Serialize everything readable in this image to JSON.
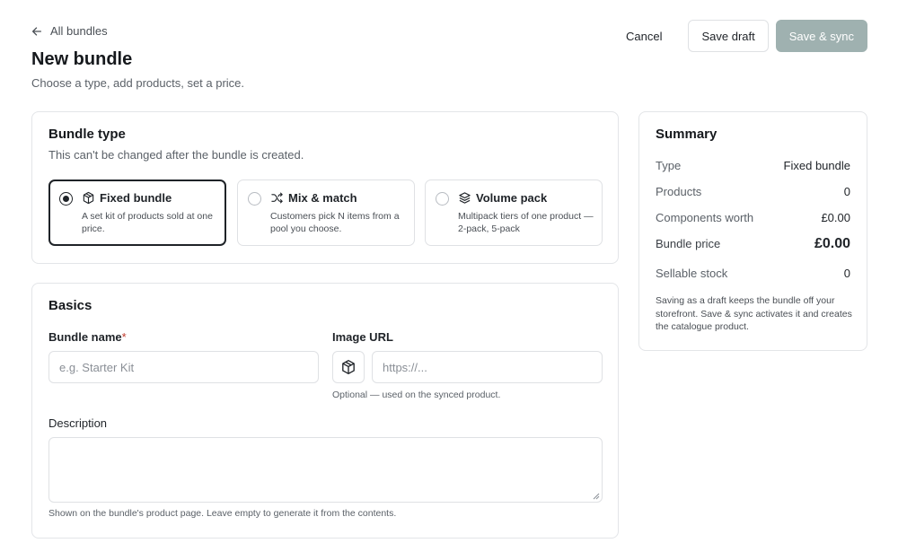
{
  "header": {
    "back_label": "All bundles",
    "title": "New bundle",
    "subtitle": "Choose a type, add products, set a price."
  },
  "actions": {
    "cancel_label": "Cancel",
    "save_draft_label": "Save draft",
    "save_sync_label": "Save & sync"
  },
  "bundle_type": {
    "title": "Bundle type",
    "subtitle": "This can't be changed after the bundle is created.",
    "options": [
      {
        "title": "Fixed bundle",
        "description": "A set kit of products sold at one price.",
        "icon": "package-icon",
        "selected": true
      },
      {
        "title": "Mix & match",
        "description": "Customers pick N items from a pool you choose.",
        "icon": "shuffle-icon",
        "selected": false
      },
      {
        "title": "Volume pack",
        "description": "Multipack tiers of one product — 2-pack, 5-pack",
        "icon": "layers-icon",
        "selected": false
      }
    ]
  },
  "basics": {
    "title": "Basics",
    "bundle_name_label": "Bundle name",
    "required_mark": "*",
    "bundle_name_placeholder": "e.g. Starter Kit",
    "image_url_label": "Image URL",
    "image_url_placeholder": "https://...",
    "image_url_hint": "Optional — used on the synced product.",
    "description_label": "Description",
    "description_hint": "Shown on the bundle's product page. Leave empty to generate it from the contents."
  },
  "summary": {
    "title": "Summary",
    "type_label": "Type",
    "type_value": "Fixed bundle",
    "products_label": "Products",
    "products_value": "0",
    "components_worth_label": "Components worth",
    "components_worth_value": "£0.00",
    "bundle_price_label": "Bundle price",
    "bundle_price_value": "£0.00",
    "sellable_stock_label": "Sellable stock",
    "sellable_stock_value": "0",
    "note": "Saving as a draft keeps the bundle off your storefront. Save & sync activates it and creates the catalogue product."
  },
  "colors": {
    "primary_button": "#9fb1b0",
    "border": "#e3e5e8",
    "text": "#1f2328",
    "muted": "#5b6168"
  }
}
